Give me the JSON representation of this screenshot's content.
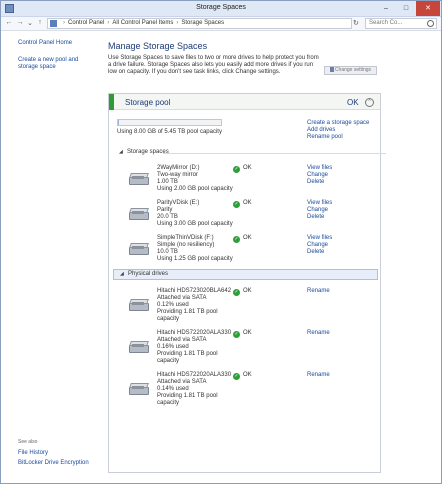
{
  "window": {
    "title": "Storage Spaces",
    "minimize": "–",
    "maximize": "□",
    "close": "✕"
  },
  "address": {
    "crumbs": [
      "Control Panel",
      "All Control Panel Items",
      "Storage Spaces"
    ],
    "search_placeholder": "Search Co...",
    "refresh": "↻"
  },
  "sidebar": {
    "links": [
      "Control Panel Home",
      "Create a new pool and storage space"
    ],
    "see_also": "See also",
    "see_also_links": [
      "File History",
      "BitLocker Drive Encryption"
    ]
  },
  "main": {
    "title": "Manage Storage Spaces",
    "intro": "Use Storage Spaces to save files to two or more drives to help protect you from a drive failure. Storage Spaces also lets you easily add more drives if you run low on capacity. If you don't see task links, click Change settings.",
    "change_settings": "Change settings"
  },
  "pool": {
    "title": "Storage pool",
    "status": "OK",
    "collapse_glyph": "⌃",
    "usage": "Using 8.00 GB of 5.45 TB pool capacity",
    "fill_fraction": 0.0015,
    "links": [
      "Create a storage space",
      "Add drives",
      "Rename pool"
    ]
  },
  "storage_spaces": {
    "header": "Storage spaces",
    "toggle": "◢",
    "items": [
      {
        "name": "2WayMirror (D:)",
        "type": "Two-way mirror",
        "size": "1.00 TB",
        "usage": "Using 2.00 GB pool capacity",
        "status": "OK",
        "links": [
          "View files",
          "Change",
          "Delete"
        ]
      },
      {
        "name": "ParityVDisk (E:)",
        "type": "Parity",
        "size": "20.0 TB",
        "usage": "Using 3.00 GB pool capacity",
        "status": "OK",
        "links": [
          "View files",
          "Change",
          "Delete"
        ]
      },
      {
        "name": "SimpleThinVDisk (F:)",
        "type": "Simple (no resiliency)",
        "size": "10.0 TB",
        "usage": "Using 1.25 GB pool capacity",
        "status": "OK",
        "links": [
          "View files",
          "Change",
          "Delete"
        ]
      }
    ]
  },
  "physical_drives": {
    "header": "Physical drives",
    "toggle": "◢",
    "items": [
      {
        "name": "Hitachi HDS723020BLA642",
        "connection": "Attached via SATA",
        "used": "0.12% used",
        "providing": "Providing 1.81 TB pool",
        "providing2": "capacity",
        "status": "OK",
        "link": "Rename"
      },
      {
        "name": "Hitachi HDS722020ALA330",
        "connection": "Attached via SATA",
        "used": "0.16% used",
        "providing": "Providing 1.81 TB pool",
        "providing2": "capacity",
        "status": "OK",
        "link": "Rename"
      },
      {
        "name": "Hitachi HDS722020ALA330",
        "connection": "Attached via SATA",
        "used": "0.14% used",
        "providing": "Providing 1.81 TB pool",
        "providing2": "capacity",
        "status": "OK",
        "link": "Rename"
      }
    ]
  },
  "ok_glyph": "✓",
  "colors": {
    "accent_green": "#2f9a36",
    "link_blue": "#1a4a9c",
    "heading_blue": "#1e3a78"
  },
  "icons": [
    "storage-spaces-icon",
    "back-icon",
    "forward-icon",
    "up-icon",
    "search-icon",
    "shield-icon",
    "collapse-icon",
    "drive-icon",
    "ok-icon"
  ]
}
